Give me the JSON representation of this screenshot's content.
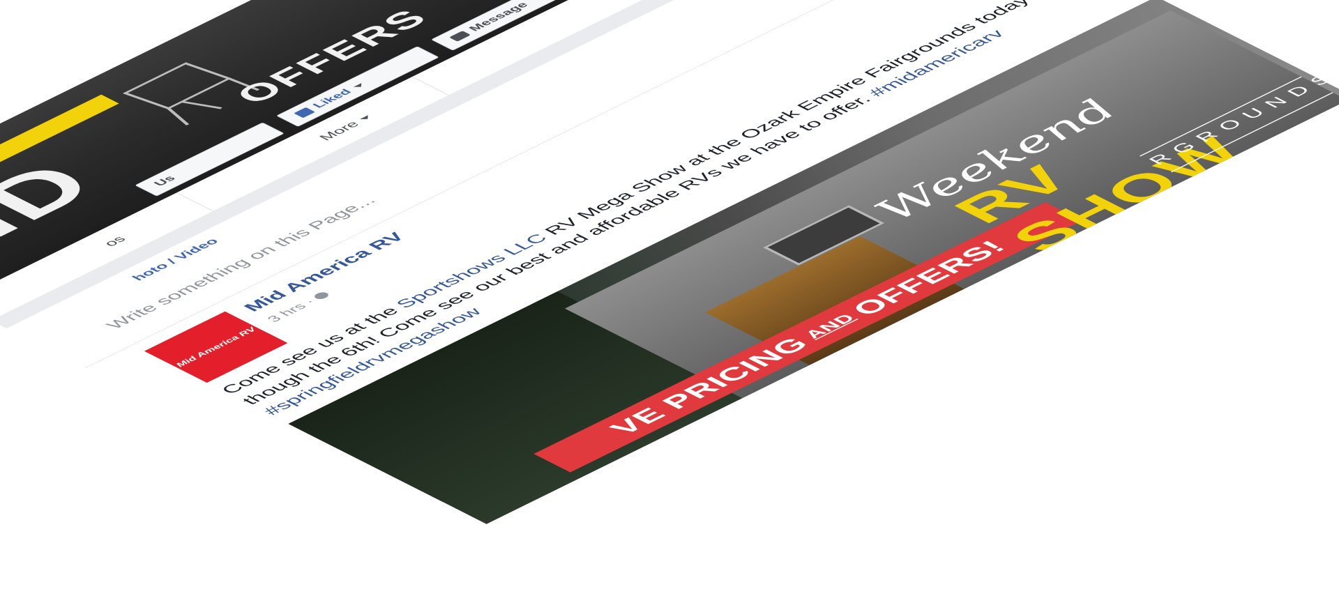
{
  "cover": {
    "headline": "ND",
    "subhead": "OFFERS"
  },
  "header_buttons": {
    "contact_label": "Us",
    "liked_label": "Liked",
    "message_label": "Message",
    "more_dots": "•••"
  },
  "nav": {
    "tab1": "os",
    "tab2": "",
    "more_label": "More"
  },
  "composer": {
    "tab_label": "hoto / Video",
    "placeholder": "Write something on this Page..."
  },
  "post": {
    "author": "Mid America RV",
    "avatar_text": "Mid America RV",
    "time": "3 hrs",
    "text_before_link": "Come see us at the ",
    "link_text": "Sportshows LLC",
    "text_after_link": " RV Mega Show at the Ozark Empire Fairgrounds today though the 6th! Come see our best and affordable RVs we have to offer. ",
    "hashtags": "#midamericarv #springfieldrvmegashow"
  },
  "post_image": {
    "banner_left": "VE PRICING",
    "banner_and": "AND",
    "banner_right": "OFFERS!",
    "script": "Weekend",
    "rv_show": "RV SHOW",
    "grounds": "RGROUNDS"
  },
  "colors": {
    "facebook_blue": "#4267b2",
    "link_blue": "#365899",
    "brand_red": "#e21f2a",
    "banner_red": "#e03a3e",
    "accent_yellow": "#f2d20a"
  },
  "icons": [
    "liked-thumb-icon",
    "message-icon",
    "caret-down-icon",
    "globe-icon",
    "avatar-icon",
    "chevron-down-icon"
  ]
}
